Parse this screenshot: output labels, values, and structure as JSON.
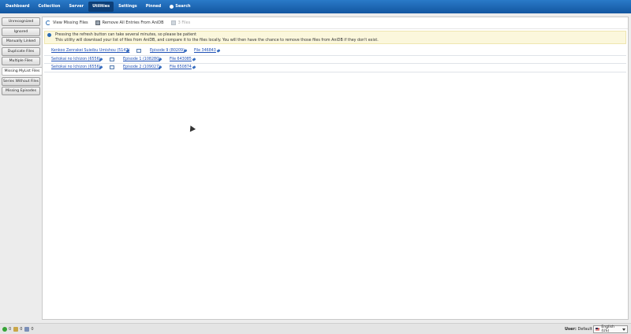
{
  "nav": {
    "items": [
      {
        "label": "Dashboard",
        "active": false
      },
      {
        "label": "Collection",
        "active": false
      },
      {
        "label": "Server",
        "active": false
      },
      {
        "label": "Utilities",
        "active": true
      },
      {
        "label": "Settings",
        "active": false
      },
      {
        "label": "Pinned",
        "active": false
      },
      {
        "label": "Search",
        "active": false,
        "icon": "search-icon"
      }
    ]
  },
  "sidebar": {
    "items": [
      {
        "label": "Unrecognized",
        "active": false
      },
      {
        "label": "Ignored",
        "active": false
      },
      {
        "label": "Manually Linked",
        "active": false
      },
      {
        "label": "Duplicate Files",
        "active": false
      },
      {
        "label": "Multiple Files",
        "active": false
      },
      {
        "label": "Missing MyList Files",
        "active": true
      },
      {
        "label": "Series Without Files",
        "active": false
      },
      {
        "label": "Missing Episodes",
        "active": false
      }
    ]
  },
  "toolbar": {
    "view_missing": "View Missing Files",
    "remove_all": "Remove All Entries From AniDB",
    "files_count": "3 Files"
  },
  "info": {
    "line1": "Pressing the refresh button can take several minutes, so please be patient",
    "line2": "This utility will download your list of files from AniDB, and compare it to the files locally. You will then have the chance to remove those files from AniDB if they don't exist."
  },
  "rows": [
    {
      "series": "Kenkoo Zenrakei Suieibu Umishou (5147)",
      "episode": "Episode 9 (80209)",
      "file": "File 346843"
    },
    {
      "series": "Seitokai no Ichizon (6556)",
      "episode": "Episode 1 (108280)",
      "file": "File 643085"
    },
    {
      "series": "Seitokai no Ichizon (6556)",
      "episode": "Episode 2 (109027)",
      "file": "File 650874"
    }
  ],
  "status": {
    "queue_general": "0",
    "queue_hash": "0",
    "queue_images": "0",
    "user_label": "User:",
    "user_value": "Default",
    "language": "English (US)"
  },
  "colors": {
    "topbar": "#1a62b0",
    "link": "#1d4fb5",
    "info_bg": "#fbf7dc"
  }
}
